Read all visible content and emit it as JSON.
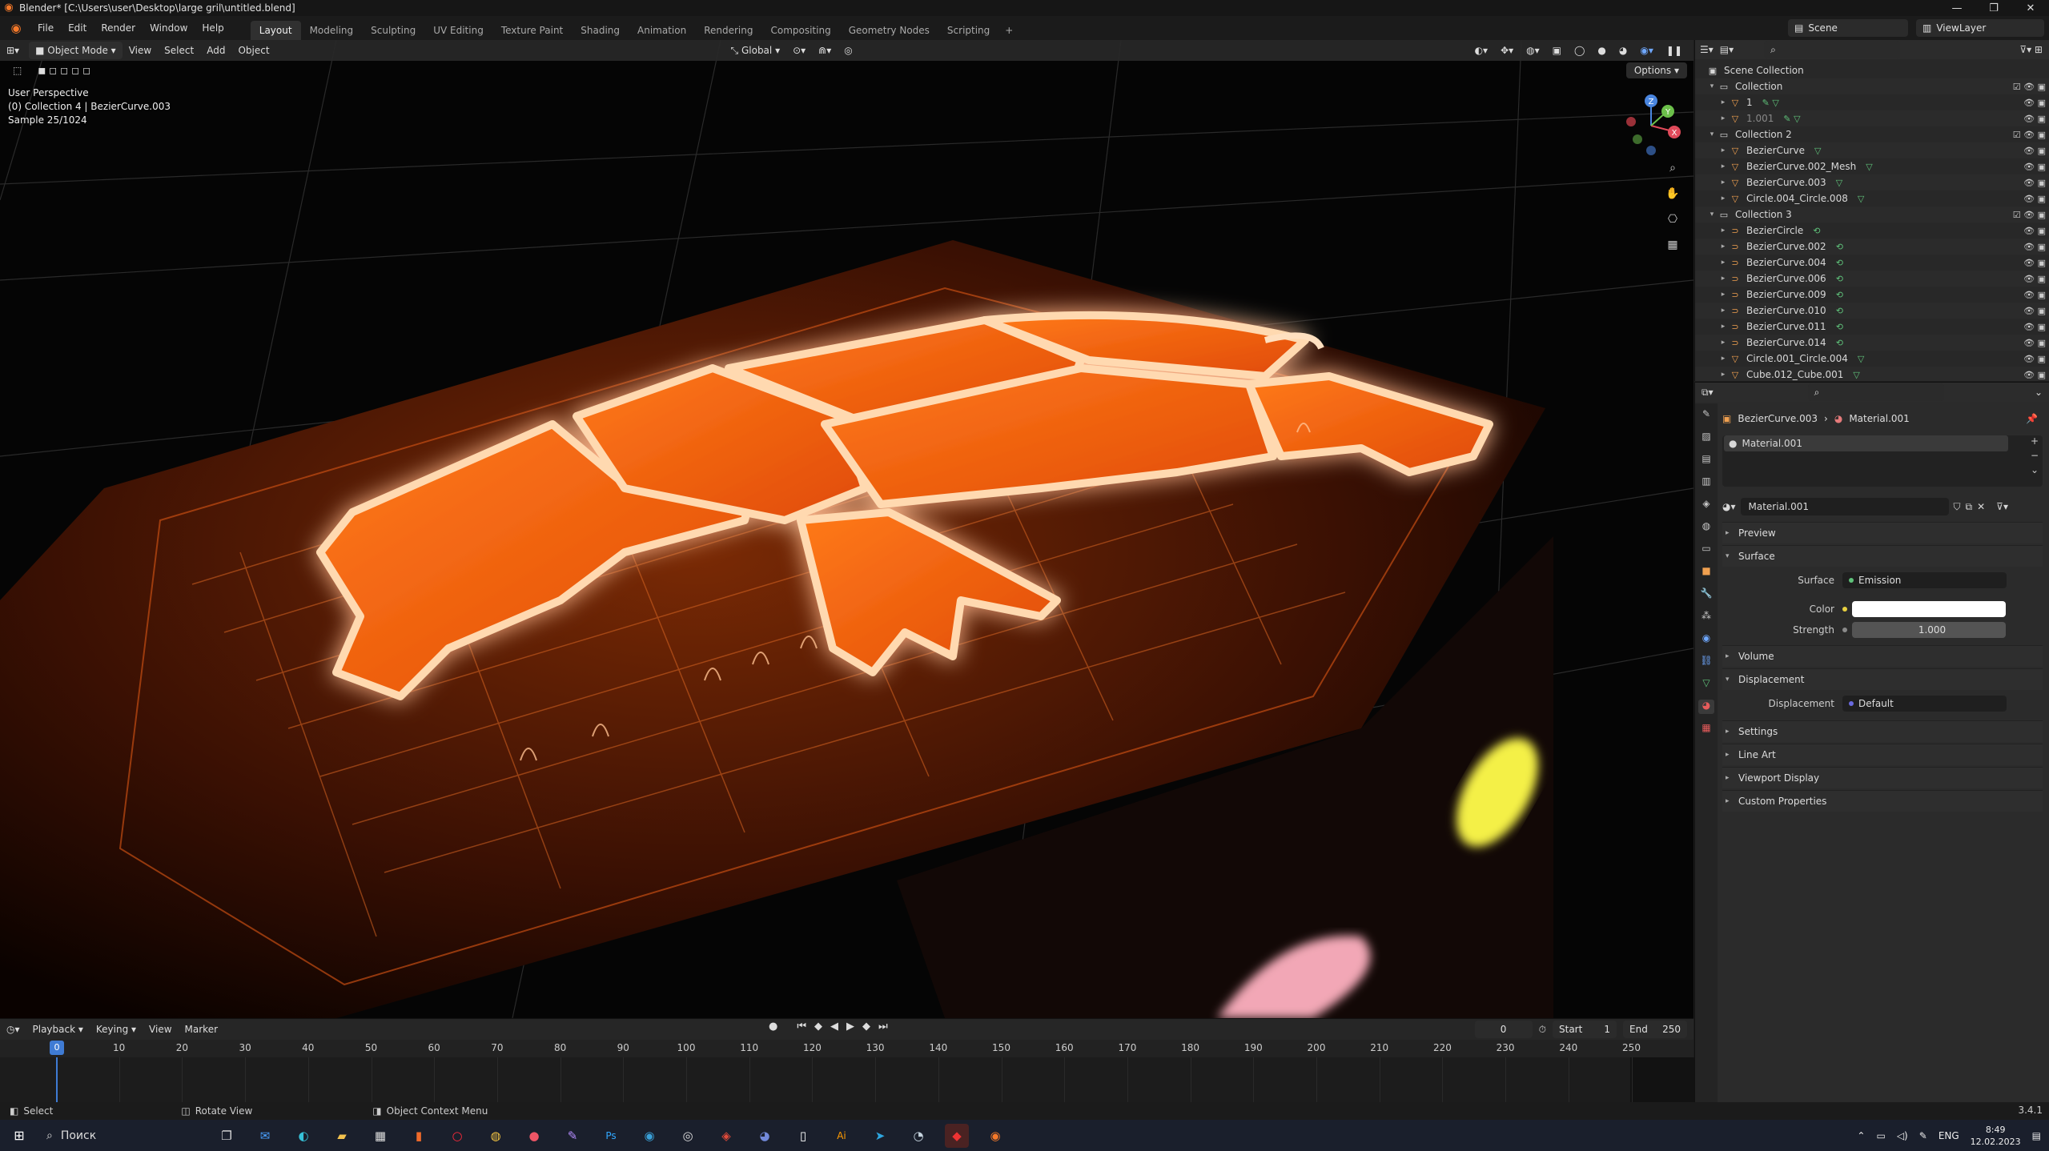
{
  "window": {
    "title": "Blender* [C:\\Users\\user\\Desktop\\large gril\\untitled.blend]",
    "controls": [
      "—",
      "❐",
      "✕"
    ]
  },
  "menubar": {
    "menus": [
      "File",
      "Edit",
      "Render",
      "Window",
      "Help"
    ],
    "tabs": [
      "Layout",
      "Modeling",
      "Sculpting",
      "UV Editing",
      "Texture Paint",
      "Shading",
      "Animation",
      "Rendering",
      "Compositing",
      "Geometry Nodes",
      "Scripting"
    ],
    "active_tab": "Layout",
    "add_tab": "+",
    "scene": "Scene",
    "view_layer": "ViewLayer"
  },
  "viewport": {
    "mode": "Object Mode",
    "menus": [
      "View",
      "Select",
      "Add",
      "Object"
    ],
    "orientation": "Global",
    "options_label": "Options",
    "info": {
      "perspective": "User Perspective",
      "object": "(0) Collection 4 | BezierCurve.003",
      "sample": "Sample 25/1024"
    },
    "gizmo_axes": [
      "X",
      "Y",
      "Z"
    ]
  },
  "timeline": {
    "menus": [
      "Playback",
      "Keying",
      "View",
      "Marker"
    ],
    "current_frame": "0",
    "start_label": "Start",
    "start": "1",
    "end_label": "End",
    "end": "250",
    "cursor_frame": "0",
    "ticks": [
      "10",
      "20",
      "30",
      "40",
      "50",
      "60",
      "70",
      "80",
      "90",
      "100",
      "110",
      "120",
      "130",
      "140",
      "150",
      "160",
      "170",
      "180",
      "190",
      "200",
      "210",
      "220",
      "230",
      "240",
      "250"
    ]
  },
  "statusbar": {
    "select": "Select",
    "rotate": "Rotate View",
    "context": "Object Context Menu",
    "version": "3.4.1"
  },
  "outliner": {
    "root": "Scene Collection",
    "rows": [
      {
        "indent": 1,
        "arrow": "▾",
        "icon": "▭",
        "label": "Collection",
        "color": "#d8d8d8",
        "extra": "",
        "check": true,
        "dim": false
      },
      {
        "indent": 2,
        "arrow": "▸",
        "icon": "▽",
        "label": "1",
        "color": "#f0a050",
        "extra": "✎ ▽",
        "check": false,
        "dim": false
      },
      {
        "indent": 2,
        "arrow": "▸",
        "icon": "▽",
        "label": "1.001",
        "color": "#f0a050",
        "extra": "✎ ▽",
        "check": false,
        "dim": true
      },
      {
        "indent": 1,
        "arrow": "▾",
        "icon": "▭",
        "label": "Collection 2",
        "color": "#d8d8d8",
        "extra": "",
        "check": true,
        "dim": false
      },
      {
        "indent": 2,
        "arrow": "▸",
        "icon": "▽",
        "label": "BezierCurve",
        "color": "#f0a050",
        "extra": "▽",
        "check": false,
        "dim": false
      },
      {
        "indent": 2,
        "arrow": "▸",
        "icon": "▽",
        "label": "BezierCurve.002_Mesh",
        "color": "#f0a050",
        "extra": "▽",
        "check": false,
        "dim": false
      },
      {
        "indent": 2,
        "arrow": "▸",
        "icon": "▽",
        "label": "BezierCurve.003",
        "color": "#f0a050",
        "extra": "▽",
        "check": false,
        "dim": false
      },
      {
        "indent": 2,
        "arrow": "▸",
        "icon": "▽",
        "label": "Circle.004_Circle.008",
        "color": "#f0a050",
        "extra": "▽",
        "check": false,
        "dim": false
      },
      {
        "indent": 1,
        "arrow": "▾",
        "icon": "▭",
        "label": "Collection 3",
        "color": "#d8d8d8",
        "extra": "",
        "check": true,
        "dim": false
      },
      {
        "indent": 2,
        "arrow": "▸",
        "icon": "⊃",
        "label": "BezierCircle",
        "color": "#f0a050",
        "extra": "⟲",
        "check": false,
        "dim": false
      },
      {
        "indent": 2,
        "arrow": "▸",
        "icon": "⊃",
        "label": "BezierCurve.002",
        "color": "#f0a050",
        "extra": "⟲",
        "check": false,
        "dim": false
      },
      {
        "indent": 2,
        "arrow": "▸",
        "icon": "⊃",
        "label": "BezierCurve.004",
        "color": "#f0a050",
        "extra": "⟲",
        "check": false,
        "dim": false
      },
      {
        "indent": 2,
        "arrow": "▸",
        "icon": "⊃",
        "label": "BezierCurve.006",
        "color": "#f0a050",
        "extra": "⟲",
        "check": false,
        "dim": false
      },
      {
        "indent": 2,
        "arrow": "▸",
        "icon": "⊃",
        "label": "BezierCurve.009",
        "color": "#f0a050",
        "extra": "⟲",
        "check": false,
        "dim": false
      },
      {
        "indent": 2,
        "arrow": "▸",
        "icon": "⊃",
        "label": "BezierCurve.010",
        "color": "#f0a050",
        "extra": "⟲",
        "check": false,
        "dim": false
      },
      {
        "indent": 2,
        "arrow": "▸",
        "icon": "⊃",
        "label": "BezierCurve.011",
        "color": "#f0a050",
        "extra": "⟲",
        "check": false,
        "dim": false
      },
      {
        "indent": 2,
        "arrow": "▸",
        "icon": "⊃",
        "label": "BezierCurve.014",
        "color": "#f0a050",
        "extra": "⟲",
        "check": false,
        "dim": false
      },
      {
        "indent": 2,
        "arrow": "▸",
        "icon": "▽",
        "label": "Circle.001_Circle.004",
        "color": "#f0a050",
        "extra": "▽",
        "check": false,
        "dim": false
      },
      {
        "indent": 2,
        "arrow": "▸",
        "icon": "▽",
        "label": "Cube.012_Cube.001",
        "color": "#f0a050",
        "extra": "▽",
        "check": false,
        "dim": false
      }
    ]
  },
  "properties": {
    "breadcrumb_object": "BezierCurve.003",
    "breadcrumb_material": "Material.001",
    "slot_name": "Material.001",
    "material_name": "Material.001",
    "panels": {
      "preview": "Preview",
      "surface": "Surface",
      "volume": "Volume",
      "displacement": "Displacement",
      "settings": "Settings",
      "line_art": "Line Art",
      "viewport_display": "Viewport Display",
      "custom_properties": "Custom Properties"
    },
    "surface_label": "Surface",
    "surface_value": "Emission",
    "color_label": "Color",
    "strength_label": "Strength",
    "strength_value": "1.000",
    "displacement_label": "Displacement",
    "displacement_value": "Default",
    "colors": {
      "emission": "#ffffff",
      "accent": "#3f7bd4",
      "glow": "#ff6a10"
    }
  },
  "taskbar": {
    "search_placeholder": "Поиск",
    "lang": "ENG",
    "time": "8:49",
    "date": "12.02.2023"
  }
}
